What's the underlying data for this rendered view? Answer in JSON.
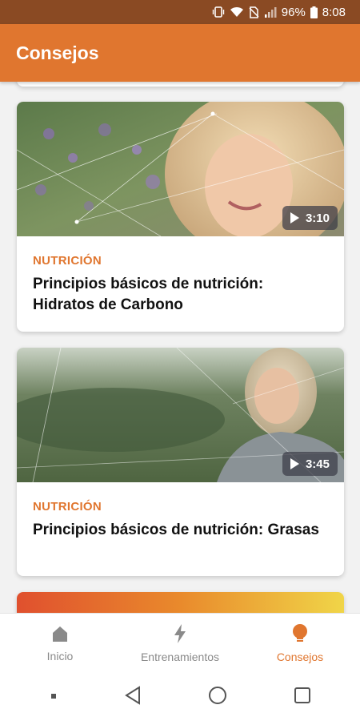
{
  "status_bar": {
    "battery_percent": "96%",
    "time": "8:08",
    "icons": [
      "vibrate-icon",
      "wifi-icon",
      "no-sim-icon",
      "signal-icon",
      "battery-icon"
    ]
  },
  "app_bar": {
    "title": "Consejos"
  },
  "cards": [
    {
      "category": "NUTRICIÓN",
      "title": "Principios básicos de nutrición: Hidratos de Carbono",
      "duration": "3:10"
    },
    {
      "category": "NUTRICIÓN",
      "title": "Principios básicos de nutrición: Grasas",
      "duration": "3:45"
    }
  ],
  "bottom_nav": {
    "items": [
      {
        "label": "Inicio",
        "icon": "home-icon",
        "active": false
      },
      {
        "label": "Entrenamientos",
        "icon": "lightning-icon",
        "active": false
      },
      {
        "label": "Consejos",
        "icon": "lightbulb-icon",
        "active": true
      }
    ]
  },
  "colors": {
    "accent": "#e0762f",
    "status_bar": "#8a4a23",
    "inactive": "#8a8a8a"
  }
}
